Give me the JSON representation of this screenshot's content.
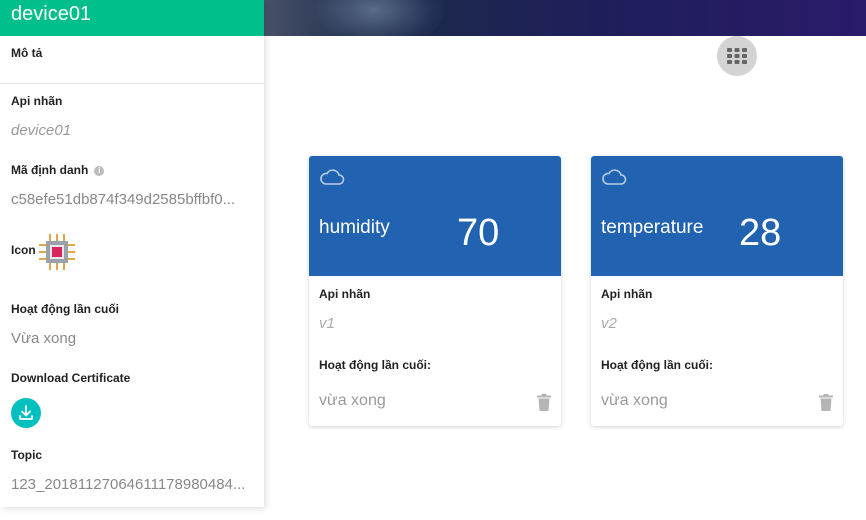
{
  "device": {
    "name": "device01",
    "description_label": "Mô tả",
    "api_label": "Api nhãn",
    "api_value": "device01",
    "id_label": "Mã định danh",
    "id_value": "c58efe51db874f349d2585bffbf0...",
    "icon_label": "Icon",
    "last_active_label": "Hoạt động lần cuối",
    "last_active_value": "Vừa xong",
    "download_label": "Download Certificate",
    "topic_label": "Topic",
    "topic_value": "123_20181127064611178980484..."
  },
  "sensors": [
    {
      "name": "humidity",
      "value": "70",
      "api_label": "Api nhãn",
      "api_value": "v1",
      "last_active_label": "Hoạt động lần cuối:",
      "last_active_value": "vừa xong"
    },
    {
      "name": "temperature",
      "value": "28",
      "api_label": "Api nhãn",
      "api_value": "v2",
      "last_active_label": "Hoạt động lần cuối:",
      "last_active_value": "vừa xong"
    }
  ],
  "colors": {
    "header_green": "#00bf8a",
    "card_blue": "#2163b0",
    "download_teal": "#00bfbf"
  },
  "icons": [
    "cloud-icon",
    "grid-icon",
    "chip-icon",
    "download-icon",
    "trash-icon",
    "info-icon"
  ]
}
